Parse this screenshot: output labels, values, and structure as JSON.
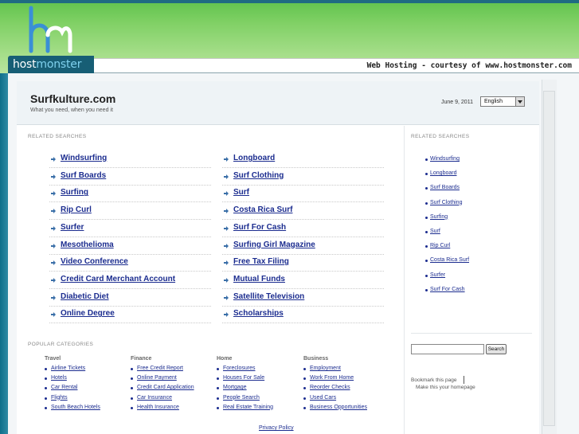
{
  "banner": {
    "wordmark_host": "host",
    "wordmark_monster": "monster",
    "courtesy": "Web Hosting - courtesy of www.hostmonster.com"
  },
  "header": {
    "site_title": "Surfkulture.com",
    "tagline": "What you need, when you need it",
    "date": "June 9, 2011",
    "language": "English"
  },
  "related_searches": {
    "label": "RELATED SEARCHES",
    "left": [
      "Windsurfing",
      "Surf Boards",
      "Surfing",
      "Rip Curl",
      "Surfer",
      "Mesothelioma",
      "Video Conference",
      "Credit Card Merchant Account",
      "Diabetic Diet",
      "Online Degree"
    ],
    "right": [
      "Longboard",
      "Surf Clothing",
      "Surf",
      "Costa Rica Surf",
      "Surf For Cash",
      "Surfing Girl Magazine",
      "Free Tax Filing",
      "Mutual Funds",
      "Satellite Television",
      "Scholarships"
    ]
  },
  "popular_categories": {
    "label": "POPULAR CATEGORIES",
    "columns": [
      {
        "heading": "Travel",
        "items": [
          "Airline Tickets",
          "Hotels",
          "Car Rental",
          "Flights",
          "South Beach Hotels"
        ]
      },
      {
        "heading": "Finance",
        "items": [
          "Free Credit Report",
          "Online Payment",
          "Credit Card Application",
          "Car Insurance",
          "Health Insurance"
        ]
      },
      {
        "heading": "Home",
        "items": [
          "Foreclosures",
          "Houses For Sale",
          "Mortgage",
          "People Search",
          "Real Estate Training"
        ]
      },
      {
        "heading": "Business",
        "items": [
          "Employment",
          "Work From Home",
          "Reorder Checks",
          "Used Cars",
          "Business Opportunities"
        ]
      }
    ]
  },
  "sidebar": {
    "label": "RELATED SEARCHES",
    "items": [
      "Windsurfing",
      "Longboard",
      "Surf Boards",
      "Surf Clothing",
      "Surfing",
      "Surf",
      "Rip Curl",
      "Costa Rica Surf",
      "Surfer",
      "Surf For Cash"
    ],
    "search_value": "",
    "search_button": "Search",
    "bookmark": "Bookmark this page",
    "homepage": "Make this your homepage"
  },
  "footer": {
    "privacy": "Privacy Policy"
  }
}
